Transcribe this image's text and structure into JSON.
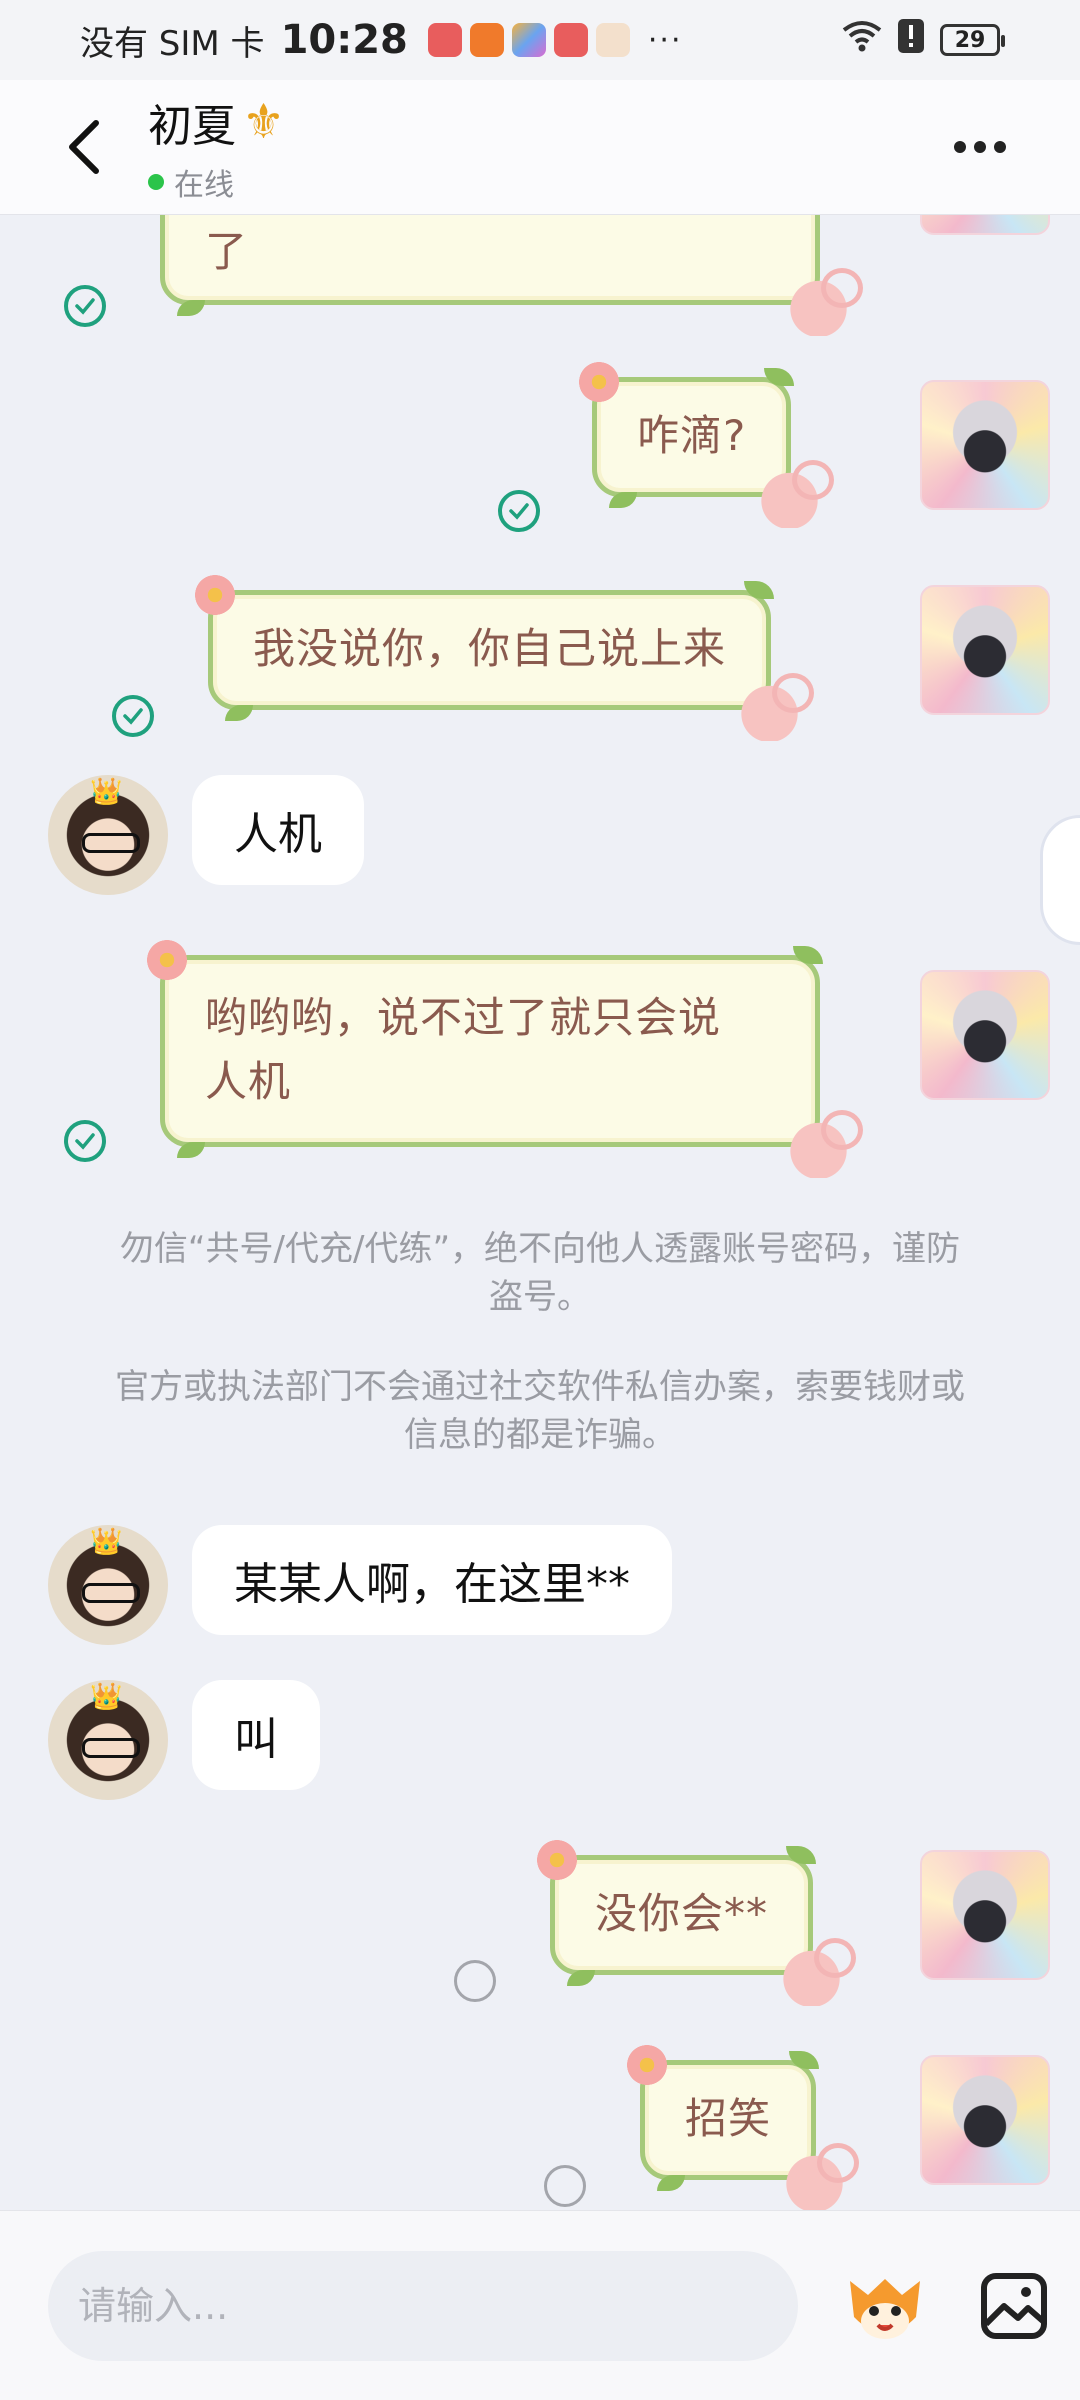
{
  "status_bar": {
    "carrier": "没有 SIM 卡",
    "time": "10:28",
    "overflow": "···",
    "battery": "29",
    "app_icon_colors": [
      "#e85d5d",
      "#f07a2b",
      "#6aa4f0",
      "#e85d5d",
      "#f3c28c"
    ]
  },
  "header": {
    "contact_name": "初夏",
    "name_icon": "fleur-de-lis-icon",
    "status": "在线"
  },
  "messages": [
    {
      "side": "right",
      "style": "decorated",
      "text": "了",
      "state": "read"
    },
    {
      "side": "right",
      "style": "decorated",
      "text": "咋滴?",
      "state": "read"
    },
    {
      "side": "right",
      "style": "decorated",
      "text": "我没说你，你自己说上来",
      "state": "read"
    },
    {
      "side": "left",
      "style": "plain",
      "text": "人机"
    },
    {
      "side": "right",
      "style": "decorated",
      "text_line1": "哟哟哟，说不过了就只会说",
      "text_line2": "人机",
      "state": "read"
    },
    {
      "side": "left",
      "style": "plain",
      "text": "某某人啊，在这里**"
    },
    {
      "side": "left",
      "style": "plain",
      "text": "叫"
    },
    {
      "side": "right",
      "style": "decorated",
      "text": "没你会**",
      "state": "pending"
    },
    {
      "side": "right",
      "style": "decorated",
      "text": "招笑",
      "state": "pending"
    }
  ],
  "notices": {
    "line1": "勿信“共号/代充/代练”，绝不向他人透露账号密码，谨防",
    "line1b": "盗号。",
    "line2": "官方或执法部门不会通过社交软件私信办案，索要钱财或",
    "line2b": "信息的都是诈骗。"
  },
  "input": {
    "placeholder": "请输入..."
  },
  "colors": {
    "accent_green": "#1fa17e",
    "online_green": "#2bc44a",
    "bubble_text": "#8a5a4e",
    "bubble_border": "#a6c97a"
  }
}
